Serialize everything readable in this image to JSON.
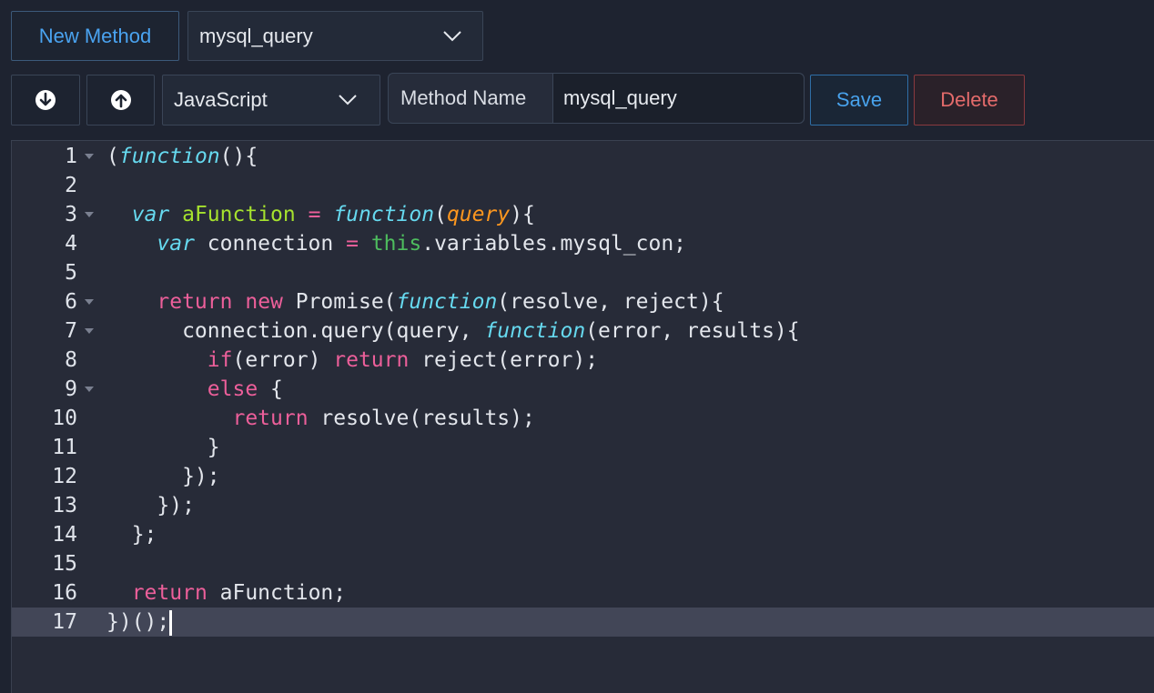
{
  "toolbar": {
    "new_method_label": "New Method",
    "method_select_value": "mysql_query",
    "language_select_value": "JavaScript",
    "method_name_label": "Method Name",
    "method_name_value": "mysql_query",
    "save_label": "Save",
    "delete_label": "Delete",
    "move_down_icon": "arrow-down-circle-icon",
    "move_up_icon": "arrow-up-circle-icon"
  },
  "colors": {
    "accent_blue": "#4aa3f0",
    "danger_red": "#e46b6b",
    "keyword": "#ec5f9a",
    "function": "#66d9ef",
    "identifier": "#a6e22e",
    "parameter": "#fd971f"
  },
  "editor": {
    "active_line": 17,
    "lines": [
      {
        "n": "1",
        "fold": true,
        "tokens": [
          [
            "p",
            "("
          ],
          [
            "fn",
            "function"
          ],
          [
            "p",
            "(){"
          ]
        ]
      },
      {
        "n": "2",
        "fold": false,
        "tokens": []
      },
      {
        "n": "3",
        "fold": true,
        "tokens": [
          [
            "p",
            "  "
          ],
          [
            "fn",
            "var"
          ],
          [
            "p",
            " "
          ],
          [
            "id",
            "aFunction"
          ],
          [
            "p",
            " "
          ],
          [
            "kw",
            "="
          ],
          [
            "p",
            " "
          ],
          [
            "fn",
            "function"
          ],
          [
            "p",
            "("
          ],
          [
            "prm",
            "query"
          ],
          [
            "p",
            "){"
          ]
        ]
      },
      {
        "n": "4",
        "fold": false,
        "tokens": [
          [
            "p",
            "    "
          ],
          [
            "fn",
            "var"
          ],
          [
            "p",
            " connection "
          ],
          [
            "kw",
            "="
          ],
          [
            "p",
            " "
          ],
          [
            "this",
            "this"
          ],
          [
            "p",
            ".variables.mysql_con;"
          ]
        ]
      },
      {
        "n": "5",
        "fold": false,
        "tokens": []
      },
      {
        "n": "6",
        "fold": true,
        "tokens": [
          [
            "p",
            "    "
          ],
          [
            "kw",
            "return"
          ],
          [
            "p",
            " "
          ],
          [
            "kw",
            "new"
          ],
          [
            "p",
            " Promise("
          ],
          [
            "fn",
            "function"
          ],
          [
            "p",
            "(resolve, reject){"
          ]
        ]
      },
      {
        "n": "7",
        "fold": true,
        "tokens": [
          [
            "p",
            "      connection.query(query, "
          ],
          [
            "fn",
            "function"
          ],
          [
            "p",
            "(error, results){"
          ]
        ]
      },
      {
        "n": "8",
        "fold": false,
        "tokens": [
          [
            "p",
            "        "
          ],
          [
            "kw",
            "if"
          ],
          [
            "p",
            "(error) "
          ],
          [
            "kw",
            "return"
          ],
          [
            "p",
            " reject(error);"
          ]
        ]
      },
      {
        "n": "9",
        "fold": true,
        "tokens": [
          [
            "p",
            "        "
          ],
          [
            "kw",
            "else"
          ],
          [
            "p",
            " {"
          ]
        ]
      },
      {
        "n": "10",
        "fold": false,
        "tokens": [
          [
            "p",
            "          "
          ],
          [
            "kw",
            "return"
          ],
          [
            "p",
            " resolve(results);"
          ]
        ]
      },
      {
        "n": "11",
        "fold": false,
        "tokens": [
          [
            "p",
            "        }"
          ]
        ]
      },
      {
        "n": "12",
        "fold": false,
        "tokens": [
          [
            "p",
            "      });"
          ]
        ]
      },
      {
        "n": "13",
        "fold": false,
        "tokens": [
          [
            "p",
            "    });"
          ]
        ]
      },
      {
        "n": "14",
        "fold": false,
        "tokens": [
          [
            "p",
            "  };"
          ]
        ]
      },
      {
        "n": "15",
        "fold": false,
        "tokens": []
      },
      {
        "n": "16",
        "fold": false,
        "tokens": [
          [
            "p",
            "  "
          ],
          [
            "kw",
            "return"
          ],
          [
            "p",
            " aFunction;"
          ]
        ]
      },
      {
        "n": "17",
        "fold": false,
        "tokens": [
          [
            "p",
            "})();"
          ]
        ]
      }
    ]
  }
}
